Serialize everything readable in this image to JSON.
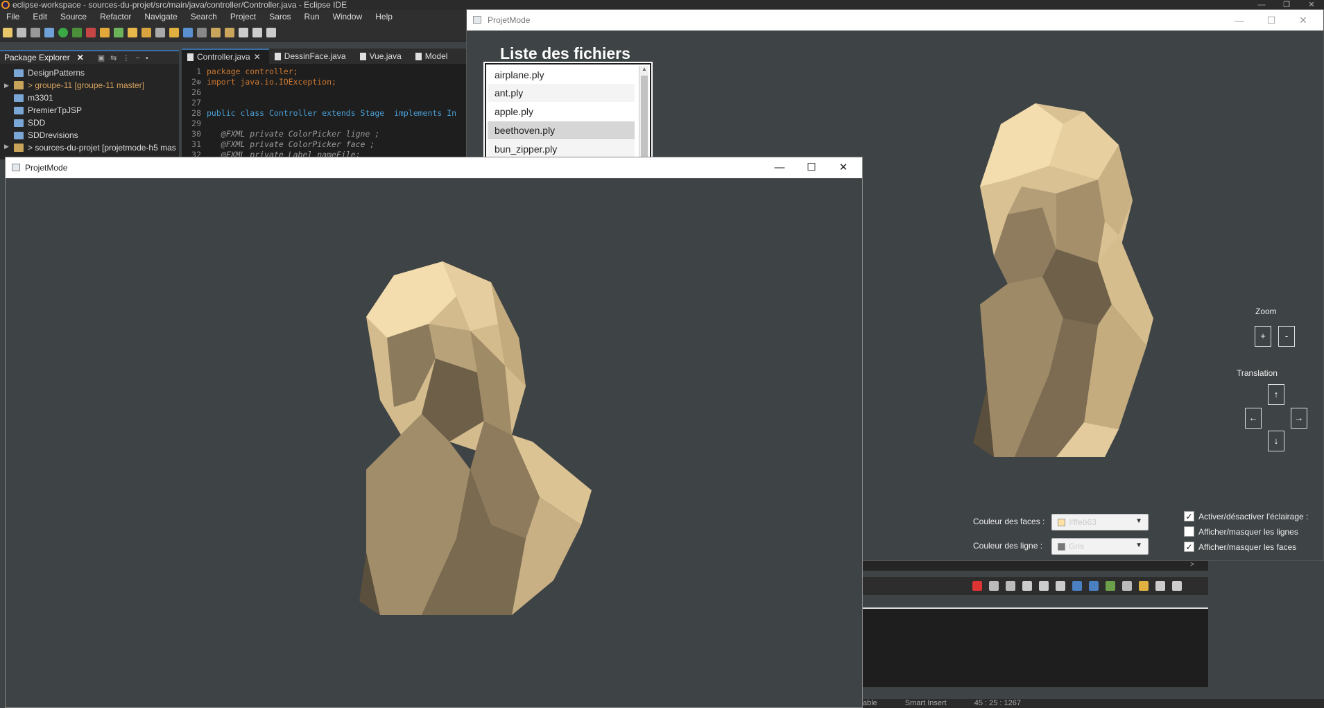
{
  "eclipse": {
    "title": "eclipse-workspace - sources-du-projet/src/main/java/controller/Controller.java - Eclipse IDE",
    "window_buttons": [
      "—",
      "❐",
      "✕"
    ],
    "menu": [
      "File",
      "Edit",
      "Source",
      "Refactor",
      "Navigate",
      "Search",
      "Project",
      "Saros",
      "Run",
      "Window",
      "Help"
    ],
    "package_explorer": {
      "tab_label": "Package Explorer",
      "items": [
        {
          "label": "DesignPatterns"
        },
        {
          "label": "> groupe-11 [groupe-11 master]"
        },
        {
          "label": "m3301"
        },
        {
          "label": "PremierTpJSP"
        },
        {
          "label": "SDD"
        },
        {
          "label": "SDDrevisions"
        },
        {
          "label": "> sources-du-projet [projetmode-h5 mas"
        }
      ]
    },
    "editor_tabs": [
      "Controller.java",
      "DessinFace.java",
      "Vue.java",
      "Model"
    ],
    "code_lines": [
      {
        "n": "1",
        "text": "package controller;"
      },
      {
        "n": "2⊕",
        "text": "import java.io.IOException;"
      },
      {
        "n": "26",
        "text": ""
      },
      {
        "n": "27",
        "text": ""
      },
      {
        "n": "28",
        "text": "public class Controller extends Stage  implements In"
      },
      {
        "n": "29",
        "text": ""
      },
      {
        "n": "30",
        "text": "   @FXML private ColorPicker ligne ;"
      },
      {
        "n": "31",
        "text": "   @FXML private ColorPicker face ;"
      },
      {
        "n": "32",
        "text": "   @FXML private Label nameFile;"
      }
    ],
    "status": [
      "able",
      "Smart Insert",
      "45 : 25 : 1267"
    ]
  },
  "window_back": {
    "title": "ProjetMode",
    "files_title": "Liste des fichiers",
    "files": [
      "airplane.ply",
      "ant.ply",
      "apple.ply",
      "beethoven.ply",
      "bun_zipper.ply"
    ],
    "selected_file": "beethoven.ply",
    "zoom_label": "Zoom",
    "zoom_in": "+",
    "zoom_out": "-",
    "translation_label": "Translation",
    "arrow_up": "↑",
    "arrow_left": "←",
    "arrow_right": "→",
    "arrow_down": "↓",
    "face_color_label": "Couleur des faces :",
    "face_color_value": "#ffeb63",
    "face_color_swatch": "#ffe1a3",
    "line_color_label": "Couleur des ligne :",
    "line_color_value": "Gris",
    "line_color_swatch": "#777777",
    "checkbox_lighting": "Activer/désactiver l'éclairage :",
    "checkbox_lines": "Afficher/masquer les lignes",
    "checkbox_faces": "Afficher/masquer les faces",
    "lighting_checked": true,
    "lines_checked": false,
    "faces_checked": true
  },
  "window_front": {
    "title": "ProjetMode"
  },
  "colors": {
    "viewport_bg": "#3e4345",
    "model_light": "#f3dcae",
    "model_mid": "#b9a37a",
    "model_dark": "#5a4e3c"
  }
}
